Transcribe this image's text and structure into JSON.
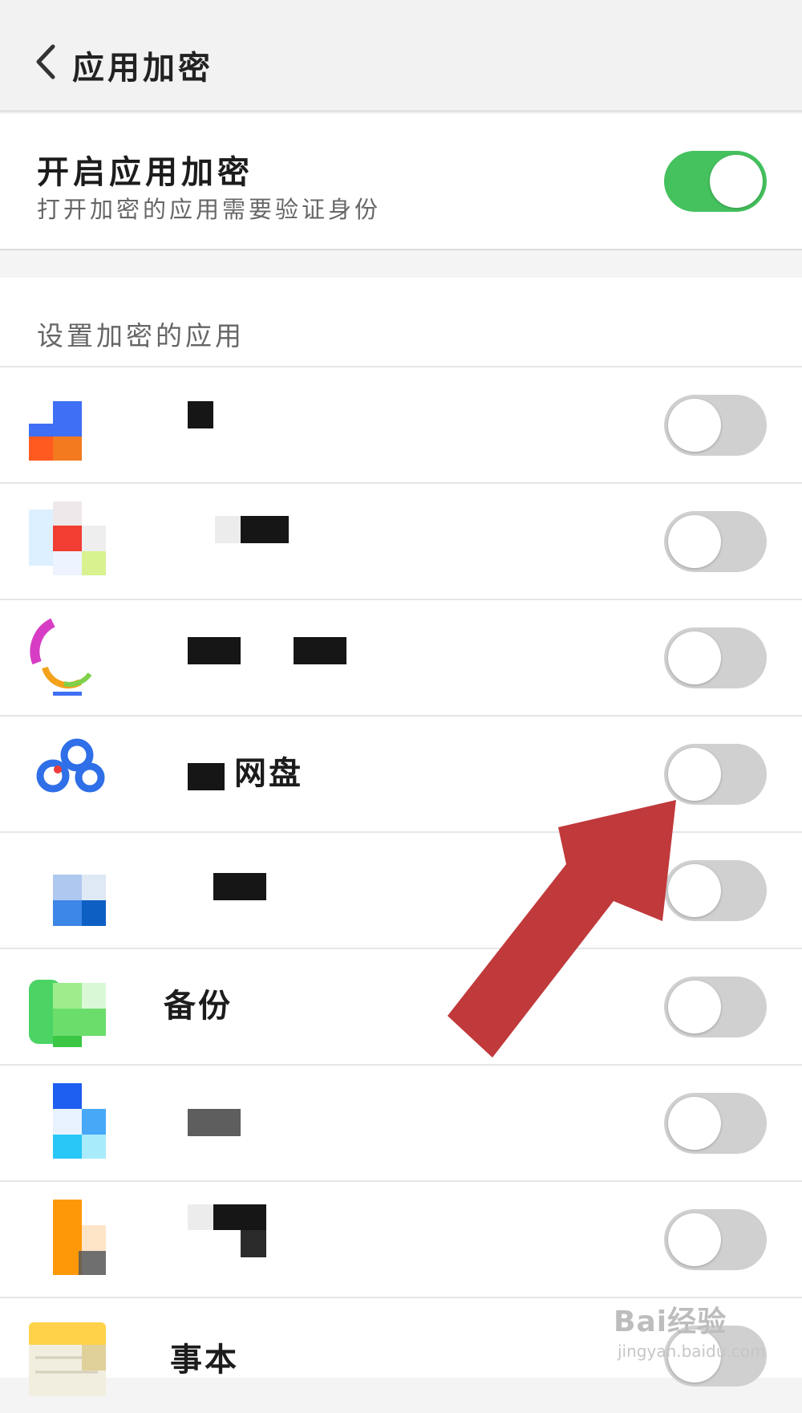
{
  "header": {
    "title": "应用加密"
  },
  "master": {
    "title": "开启应用加密",
    "subtitle": "打开加密的应用需要验证身份",
    "enabled": true
  },
  "section": {
    "label": "设置加密的应用"
  },
  "apps": [
    {
      "name": "",
      "enabled": false,
      "icon": "blue-app-icon"
    },
    {
      "name": "",
      "enabled": false,
      "icon": "red-app-icon"
    },
    {
      "name": "",
      "enabled": false,
      "icon": "colorful-ring-app-icon"
    },
    {
      "name": "网盘",
      "enabled": false,
      "icon": "cloud-drive-icon"
    },
    {
      "name": "",
      "enabled": false,
      "icon": "blue-grid-app-icon"
    },
    {
      "name": "备份",
      "enabled": false,
      "icon": "green-backup-icon"
    },
    {
      "name": "",
      "enabled": false,
      "icon": "blue-square-app-icon"
    },
    {
      "name": "",
      "enabled": false,
      "icon": "orange-app-icon"
    },
    {
      "name": "事本",
      "enabled": false,
      "icon": "notepad-icon"
    }
  ],
  "watermark": {
    "brand": "Bai经验",
    "url": "jingyan.baidu.com"
  },
  "colors": {
    "toggle_on": "#45c15e",
    "toggle_off": "#d0d0d0",
    "arrow": "#c0393b"
  }
}
